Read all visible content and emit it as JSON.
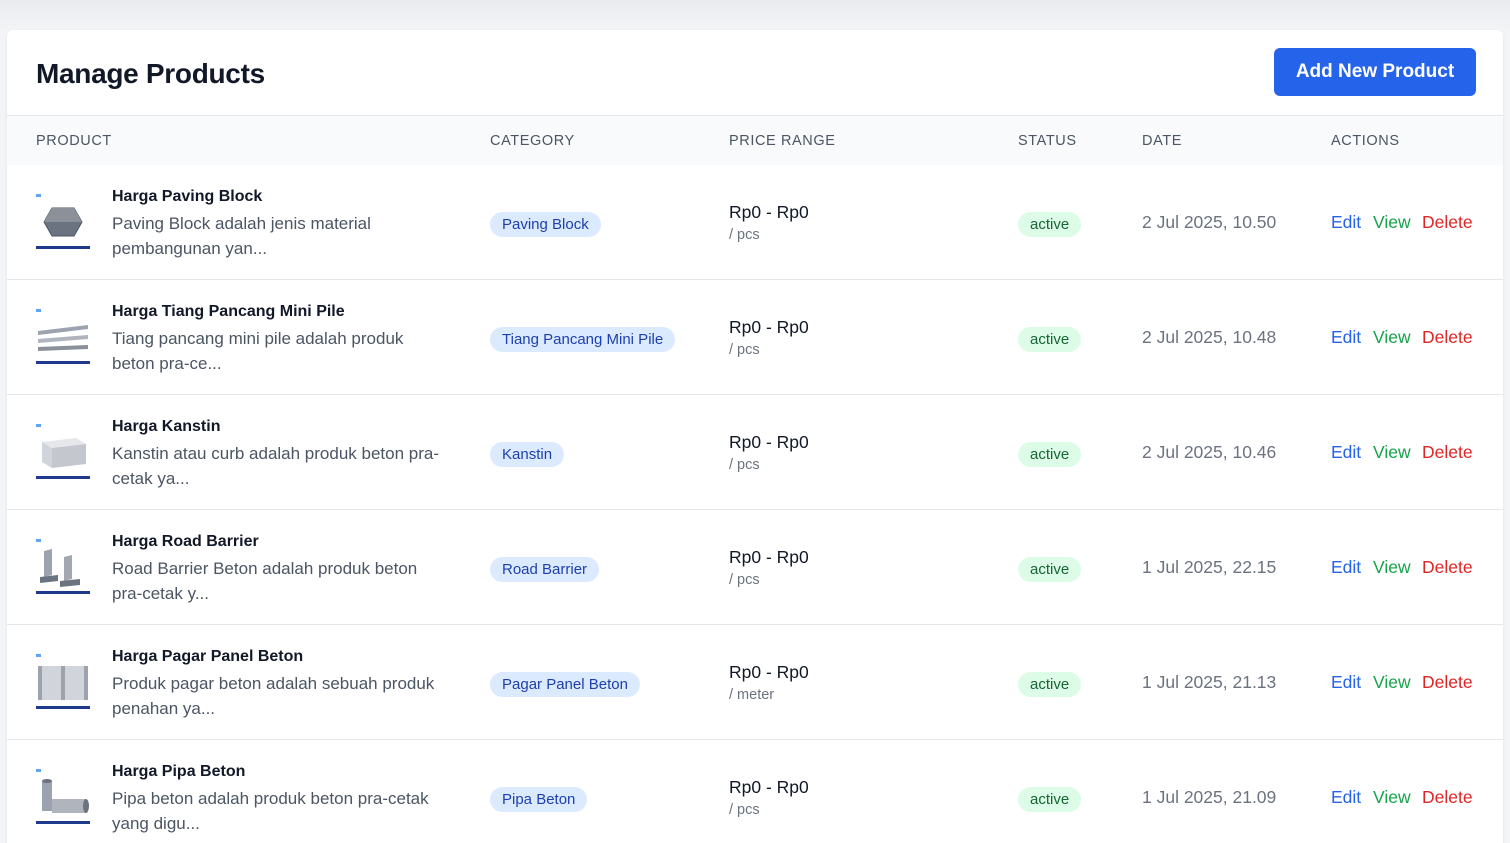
{
  "header": {
    "title": "Manage Products",
    "add_button": "Add New Product"
  },
  "table": {
    "columns": [
      "PRODUCT",
      "CATEGORY",
      "PRICE RANGE",
      "STATUS",
      "DATE",
      "ACTIONS"
    ],
    "actions": {
      "edit": "Edit",
      "view": "View",
      "delete": "Delete"
    },
    "rows": [
      {
        "name": "Harga Paving Block",
        "description": "Paving Block adalah jenis material pembangunan yan...",
        "category": "Paving Block",
        "price": "Rp0 - Rp0",
        "unit": "/ pcs",
        "status": "active",
        "date": "2 Jul 2025, 10.50",
        "thumb": "paving-block-image"
      },
      {
        "name": "Harga Tiang Pancang Mini Pile",
        "description": "Tiang pancang mini pile adalah produk beton pra-ce...",
        "category": "Tiang Pancang Mini Pile",
        "price": "Rp0 - Rp0",
        "unit": "/ pcs",
        "status": "active",
        "date": "2 Jul 2025, 10.48",
        "thumb": "mini-pile-image"
      },
      {
        "name": "Harga Kanstin",
        "description": "Kanstin atau curb adalah produk beton pra-cetak ya...",
        "category": "Kanstin",
        "price": "Rp0 - Rp0",
        "unit": "/ pcs",
        "status": "active",
        "date": "2 Jul 2025, 10.46",
        "thumb": "kanstin-image"
      },
      {
        "name": "Harga Road Barrier",
        "description": "Road Barrier Beton adalah produk beton pra-cetak y...",
        "category": "Road Barrier",
        "price": "Rp0 - Rp0",
        "unit": "/ pcs",
        "status": "active",
        "date": "1 Jul 2025, 22.15",
        "thumb": "road-barrier-image"
      },
      {
        "name": "Harga Pagar Panel Beton",
        "description": "Produk pagar beton adalah sebuah produk penahan ya...",
        "category": "Pagar Panel Beton",
        "price": "Rp0 - Rp0",
        "unit": "/ meter",
        "status": "active",
        "date": "1 Jul 2025, 21.13",
        "thumb": "panel-fence-image"
      },
      {
        "name": "Harga Pipa Beton",
        "description": "Pipa beton adalah produk beton pra-cetak yang digu...",
        "category": "Pipa Beton",
        "price": "Rp0 - Rp0",
        "unit": "/ pcs",
        "status": "active",
        "date": "1 Jul 2025, 21.09",
        "thumb": "concrete-pipe-image"
      }
    ]
  }
}
